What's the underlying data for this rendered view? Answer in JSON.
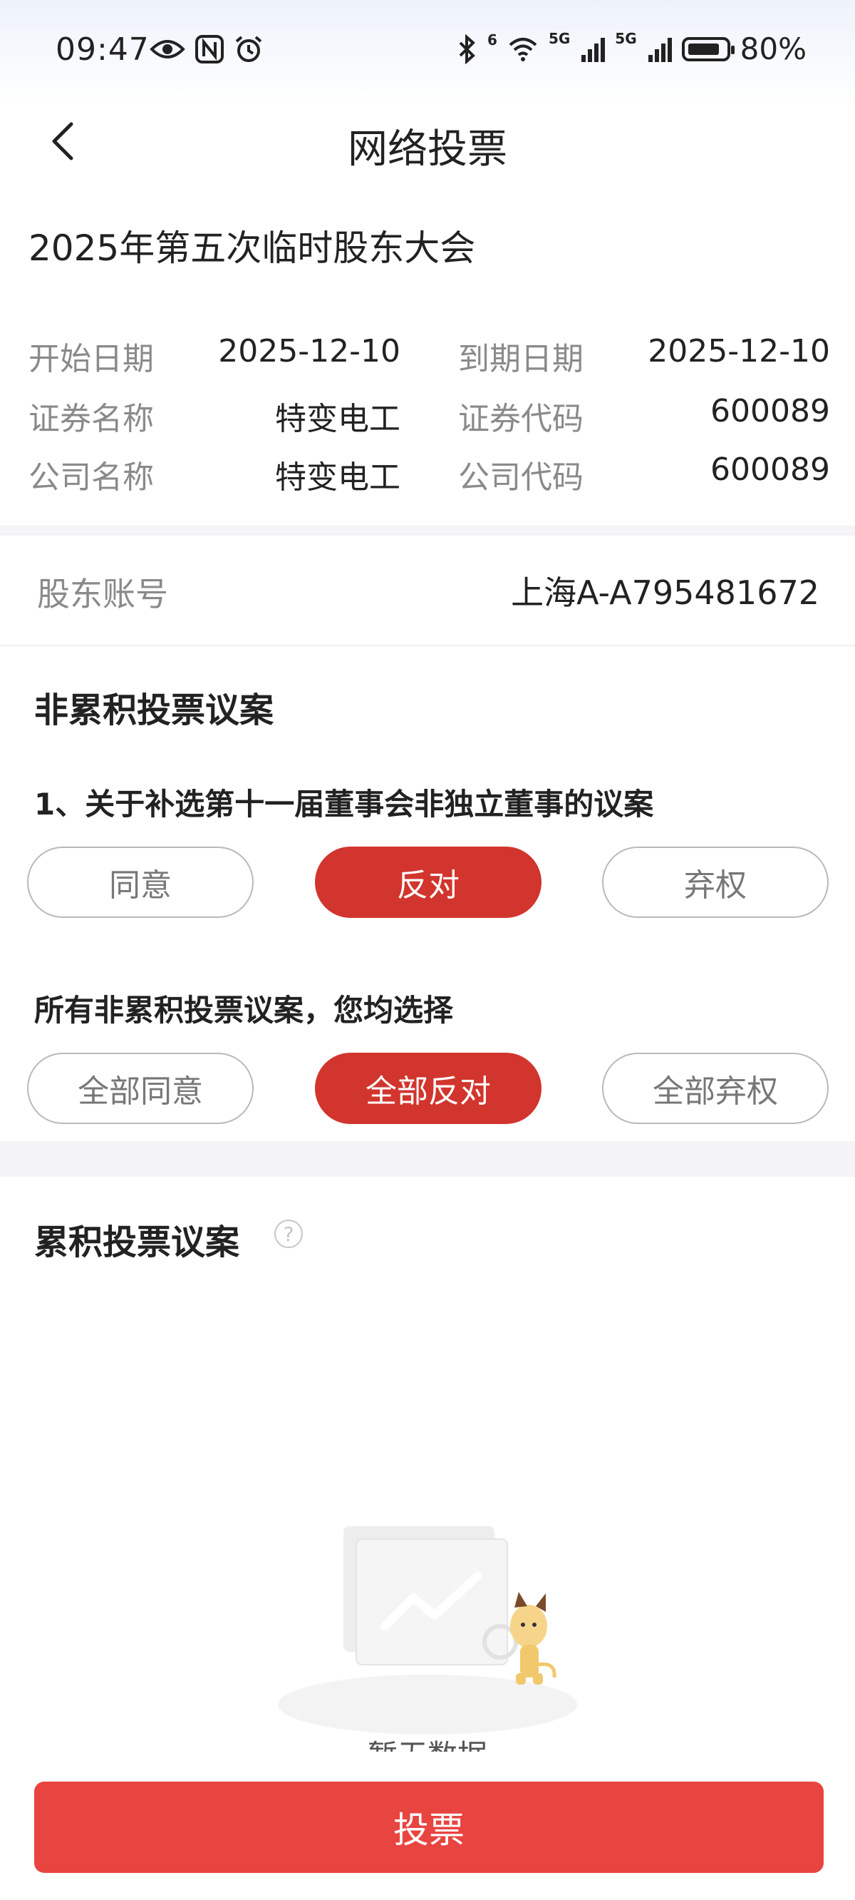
{
  "status_bar": {
    "time": "09:47",
    "battery": "80%",
    "battery_level": 0.8,
    "network_tags": [
      "5G",
      "5G"
    ],
    "wifi_badge": "6"
  },
  "header": {
    "title": "网络投票",
    "back_icon": "chevron-left-icon"
  },
  "meeting": {
    "title": "2025年第五次临时股东大会",
    "rows": [
      {
        "label1": "开始日期",
        "value1": "2025-12-10",
        "label2": "到期日期",
        "value2": "2025-12-10"
      },
      {
        "label1": "证券名称",
        "value1": "特变电工",
        "label2": "证券代码",
        "value2": "600089"
      },
      {
        "label1": "公司名称",
        "value1": "特变电工",
        "label2": "公司代码",
        "value2": "600089"
      }
    ]
  },
  "account": {
    "label": "股东账号",
    "value": "上海A-A795481672"
  },
  "non_cumulative": {
    "section_title": "非累积投票议案",
    "proposal_title": "1、关于补选第十一届董事会非独立董事的议案",
    "options": [
      "同意",
      "反对",
      "弃权"
    ],
    "selected": "反对",
    "all_title": "所有非累积投票议案，您均选择",
    "all_options": [
      "全部同意",
      "全部反对",
      "全部弃权"
    ],
    "all_selected": "全部反对"
  },
  "cumulative": {
    "section_title": "累积投票议案",
    "help_icon": "question-circle-icon",
    "help_glyph": "?",
    "empty_text": "暂无数据"
  },
  "footer": {
    "vote_label": "投票"
  },
  "colors": {
    "accent": "#d1352d",
    "vote_button": "#e84440",
    "label_gray": "#8a8a8a"
  }
}
